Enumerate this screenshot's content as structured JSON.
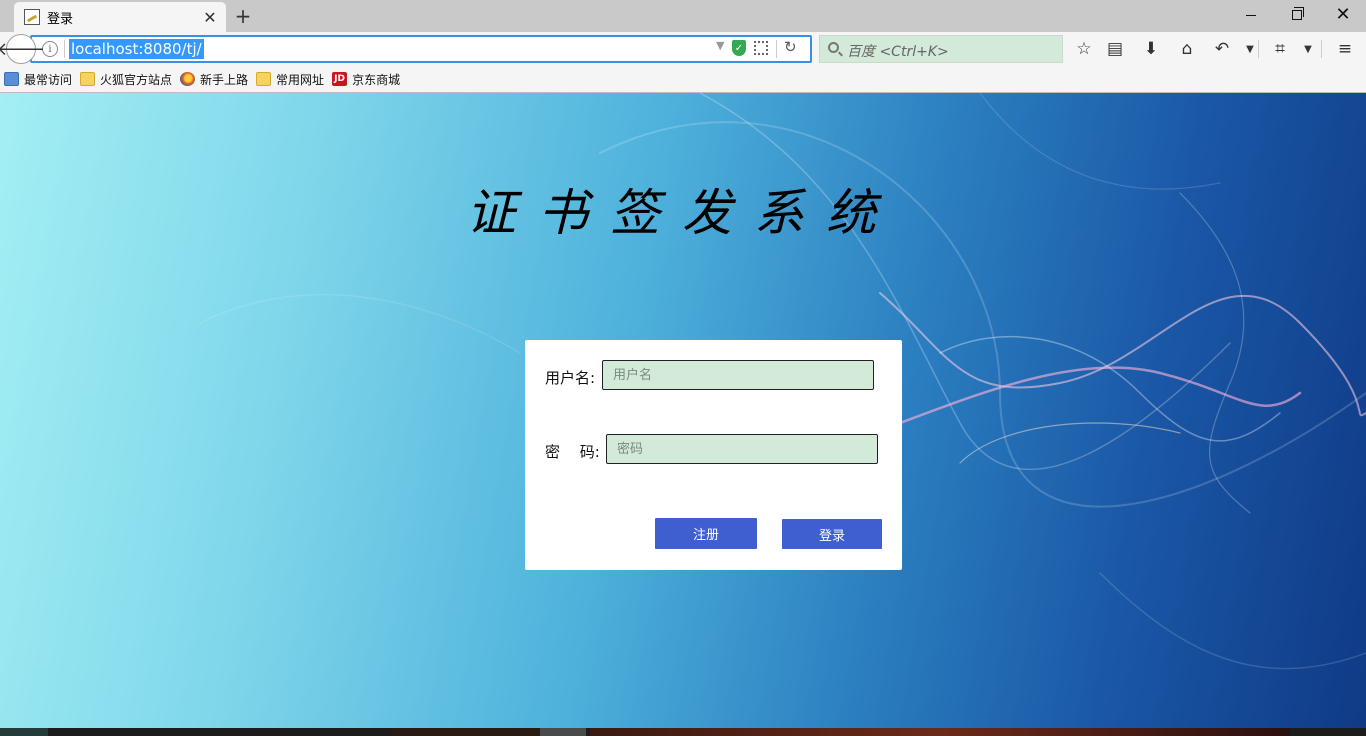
{
  "browser": {
    "tab": {
      "title": "登录"
    },
    "url": "localhost:8080/tj/",
    "search_placeholder": "百度 <Ctrl+K>",
    "bookmarks": [
      {
        "label": "最常访问",
        "icon": "recent-icon"
      },
      {
        "label": "火狐官方站点",
        "icon": "folder-icon"
      },
      {
        "label": "新手上路",
        "icon": "firefox-icon"
      },
      {
        "label": "常用网址",
        "icon": "folder-icon"
      },
      {
        "label": "京东商城",
        "icon": "jd-icon"
      }
    ]
  },
  "page": {
    "title": "证书签发系统",
    "form": {
      "username_label": "用户名:",
      "username_placeholder": "用户名",
      "password_label": "密　 码:",
      "password_placeholder": "密码",
      "register_button": "注册",
      "login_button": "登录"
    }
  },
  "colors": {
    "accent_button": "#3f5fd0",
    "input_bg": "#d2ead7",
    "url_focus": "#3a8ee6"
  }
}
